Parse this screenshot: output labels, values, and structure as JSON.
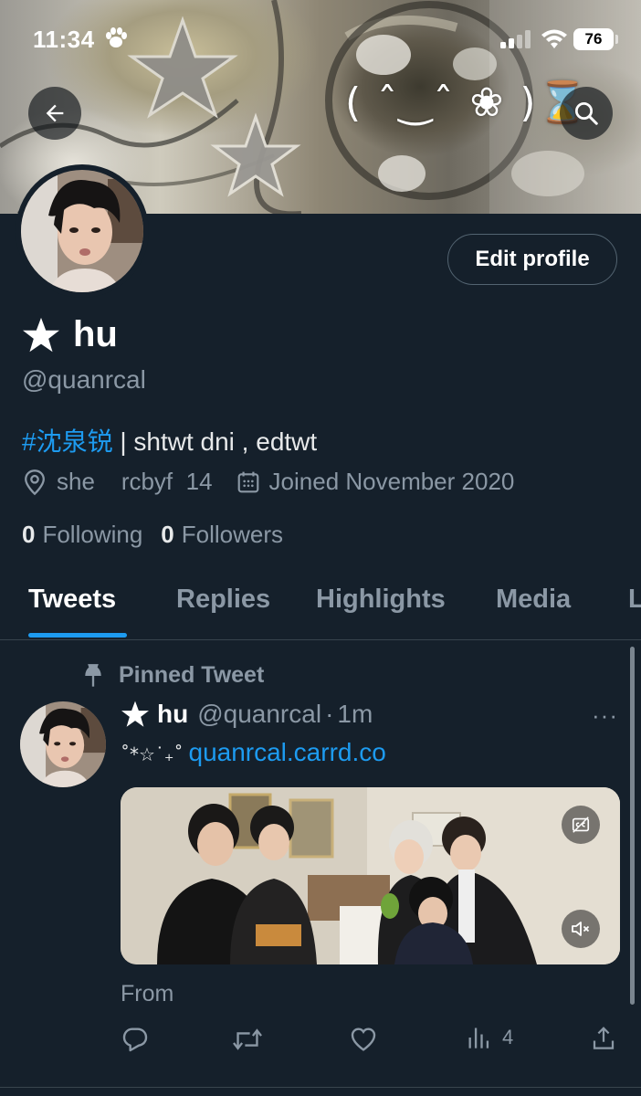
{
  "status_bar": {
    "time": "11:34",
    "battery": "76"
  },
  "banner": {
    "kaomoji": "( ˆ‿ˆ ❀ )⌛"
  },
  "profile": {
    "name": "hu",
    "handle": "@quanrcal",
    "edit_button": "Edit profile",
    "bio_tag": "#沈泉锐",
    "bio_rest": " | shtwt dni , edtwt",
    "location": "she    rcbyf  14",
    "joined": "Joined November 2020",
    "following_count": "0",
    "following_label": "Following",
    "followers_count": "0",
    "followers_label": "Followers"
  },
  "tabs": [
    {
      "label": "Tweets",
      "active": true
    },
    {
      "label": "Replies",
      "active": false
    },
    {
      "label": "Highlights",
      "active": false
    },
    {
      "label": "Media",
      "active": false
    },
    {
      "label": "L",
      "active": false
    }
  ],
  "pinned_tweet": {
    "pinned_label": "Pinned Tweet",
    "name": "hu",
    "handle": "@quanrcal",
    "separator": "·",
    "time": "1m",
    "more": "···",
    "text_symbols": "˚*☆˙₊˚",
    "link": "quanrcal.carrd.co",
    "from_label": "From",
    "views_count": "4"
  },
  "icons": {
    "back": "arrow-left-icon",
    "search": "search-icon",
    "star": "star-icon",
    "location": "location-pin-icon",
    "calendar": "calendar-icon",
    "pin": "pin-icon",
    "reply": "reply-icon",
    "retweet": "retweet-icon",
    "like": "heart-icon",
    "views": "views-icon",
    "share": "share-icon",
    "captions": "captions-icon",
    "mute": "mute-icon"
  },
  "colors": {
    "background": "#15202b",
    "accent": "#1d9bf0",
    "muted_text": "#8b98a5",
    "divider": "#38444d"
  }
}
